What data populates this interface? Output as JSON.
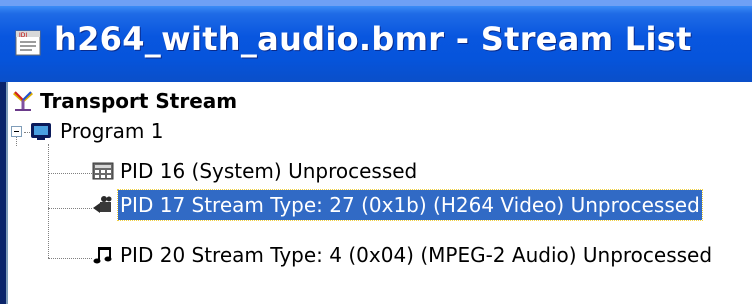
{
  "window": {
    "title": "h264_with_audio.bmr - Stream List",
    "title_icon": "document-icon"
  },
  "tree": {
    "root": {
      "label": "Transport Stream",
      "icon": "transport-stream-icon"
    },
    "program": {
      "label": "Program 1",
      "icon": "program-monitor-icon",
      "expanded": true
    },
    "pids": [
      {
        "label": "PID 16 (System) Unprocessed",
        "icon": "system-table-icon",
        "selected": false
      },
      {
        "label": "PID 17 Stream Type: 27 (0x1b) (H264 Video) Unprocessed",
        "icon": "video-camera-icon",
        "selected": true
      },
      {
        "label": "PID 20 Stream Type: 4 (0x04) (MPEG-2 Audio) Unprocessed",
        "icon": "music-note-icon",
        "selected": false
      }
    ]
  },
  "colors": {
    "title_bar": "#0856df",
    "selection": "#316ac5"
  }
}
